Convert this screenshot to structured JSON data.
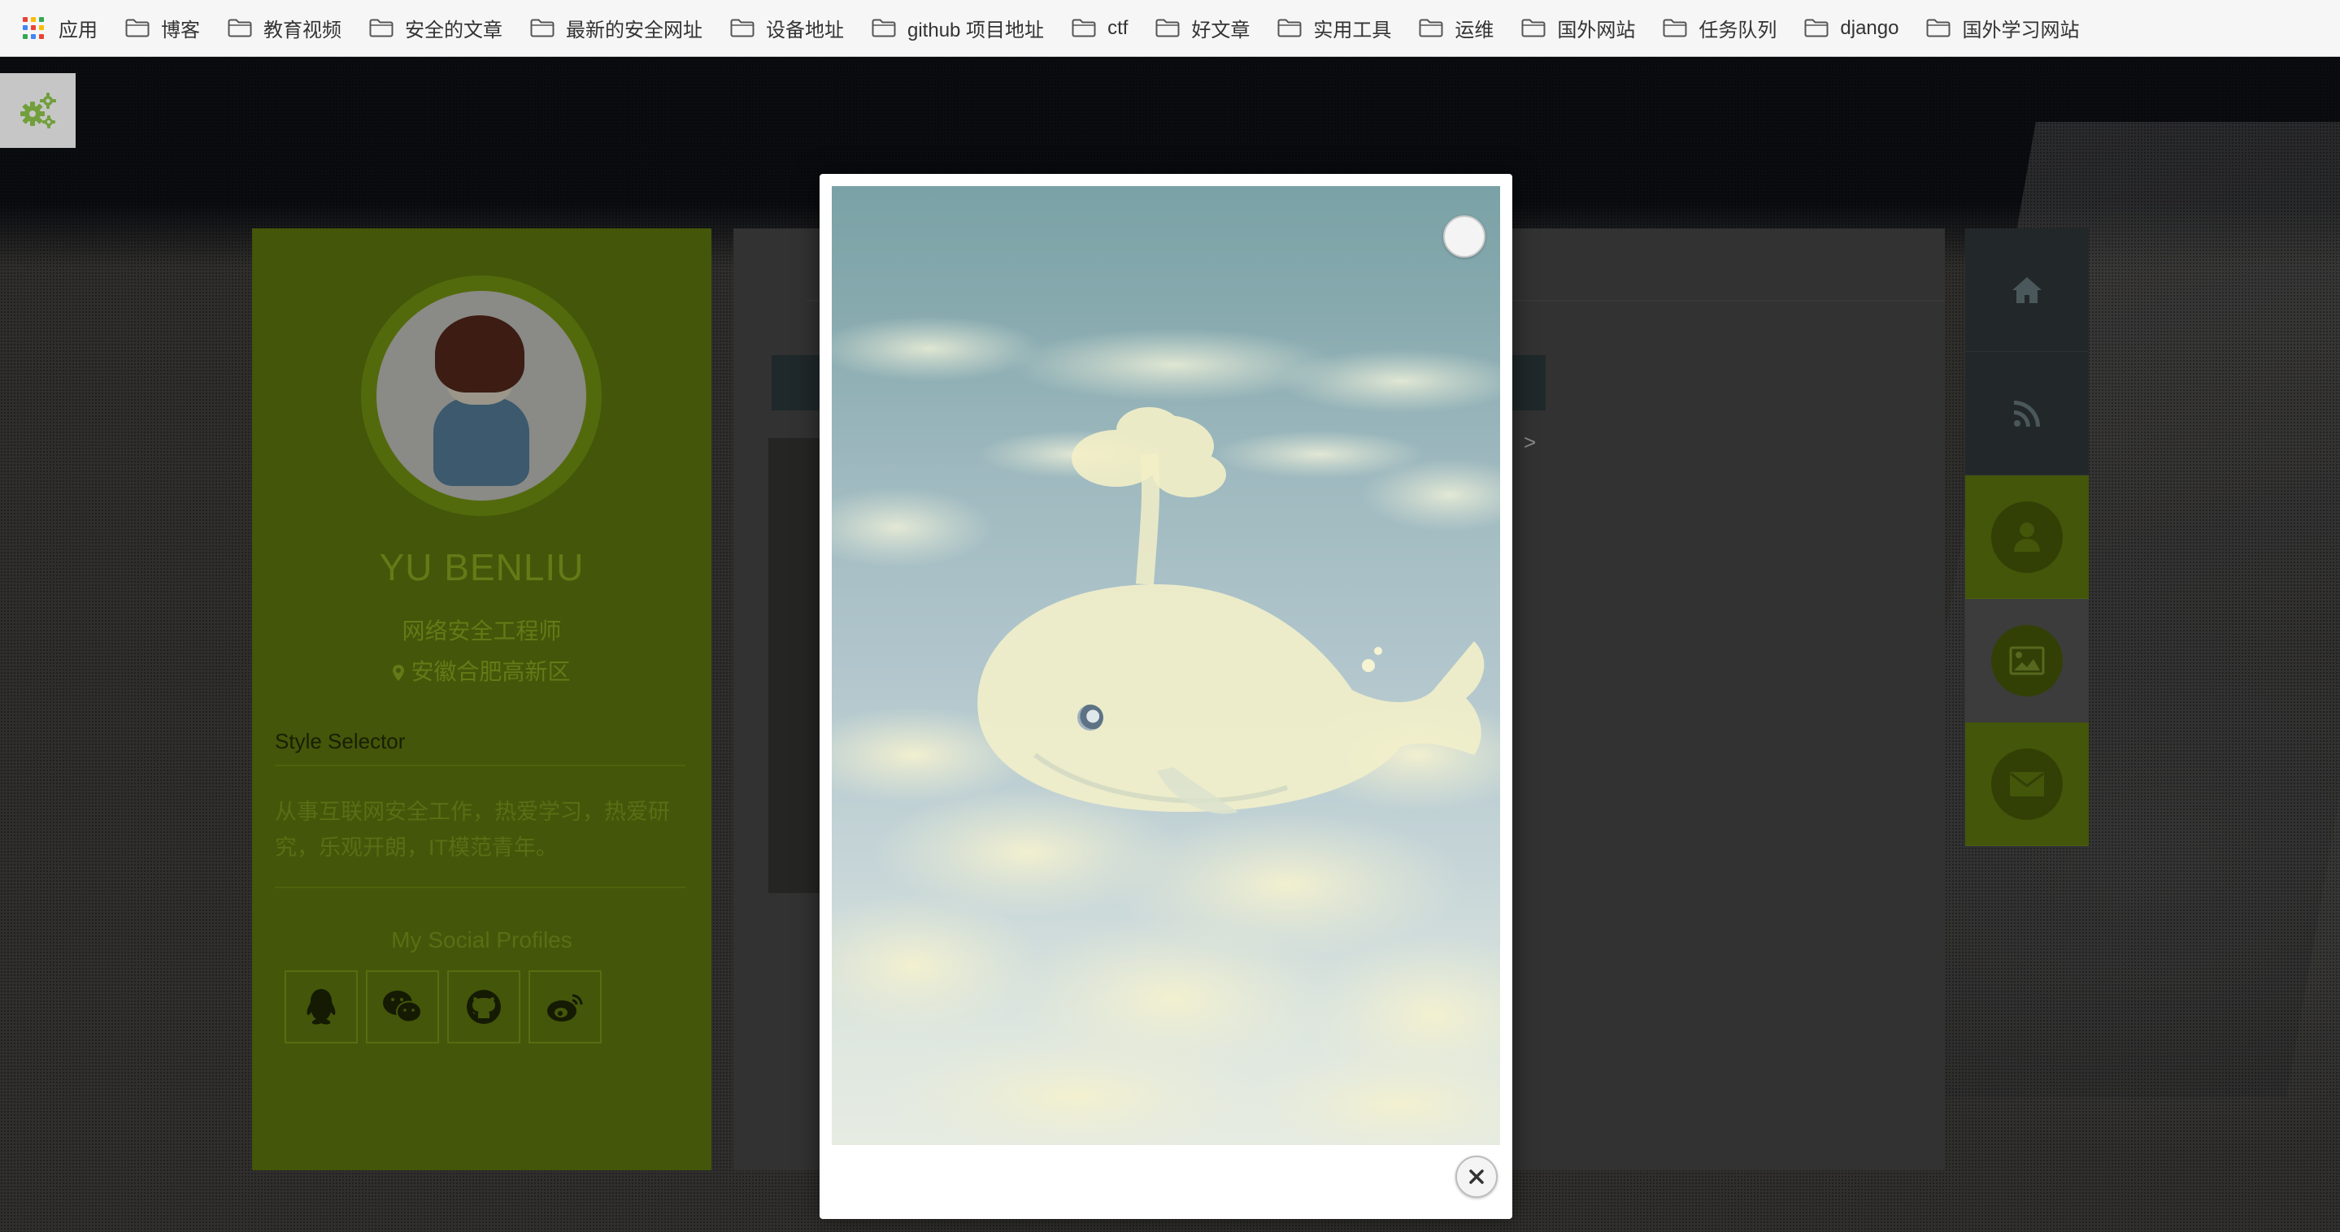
{
  "bookmarks": {
    "apps_label": "应用",
    "items": [
      "博客",
      "教育视频",
      "安全的文章",
      "最新的安全网址",
      "设备地址",
      "github 项目地址",
      "ctf",
      "好文章",
      "实用工具",
      "运维",
      "国外网站",
      "任务队列",
      "django",
      "国外学习网站"
    ]
  },
  "profile": {
    "name": "YU BENLIU",
    "job": "网络安全工程师",
    "location": "安徽合肥高新区",
    "style_selector": "Style Selector",
    "about": "从事互联网安全工作，热爱学习，热爱研究，乐观开朗，IT模范青年。",
    "social_title": "My Social Profiles",
    "social_icons": [
      "qq-icon",
      "wechat-icon",
      "github-icon",
      "weibo-icon"
    ]
  },
  "right_nav": [
    "home-icon",
    "rss-icon",
    "user-icon",
    "image-icon",
    "envelope-icon"
  ],
  "lightbox": {
    "expand_icon": "expand-icon",
    "close_icon": "close-icon"
  },
  "middle": {
    "chevron": ">"
  },
  "colors": {
    "accent_green": "#8bc34a",
    "card_green": "#536a0c"
  }
}
